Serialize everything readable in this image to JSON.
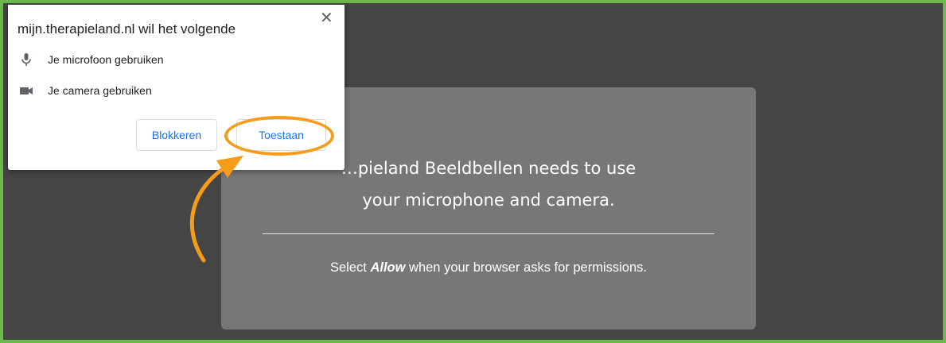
{
  "popup": {
    "title": "mijn.therapieland.nl wil het volgende",
    "close_glyph": "✕",
    "permissions": [
      {
        "icon": "microphone-icon",
        "label": "Je microfoon gebruiken"
      },
      {
        "icon": "camera-icon",
        "label": "Je camera gebruiken"
      }
    ],
    "block_label": "Blokkeren",
    "allow_label": "Toestaan"
  },
  "card": {
    "title_line1": "…pieland Beeldbellen needs to use",
    "title_line2": "your microphone and camera.",
    "hint_prefix": "Select ",
    "hint_emphasis": "Allow",
    "hint_suffix": " when your browser asks for permissions."
  },
  "colors": {
    "frame_border": "#6db84a",
    "annotation": "#f59c1a",
    "link_blue": "#1a73e8"
  }
}
